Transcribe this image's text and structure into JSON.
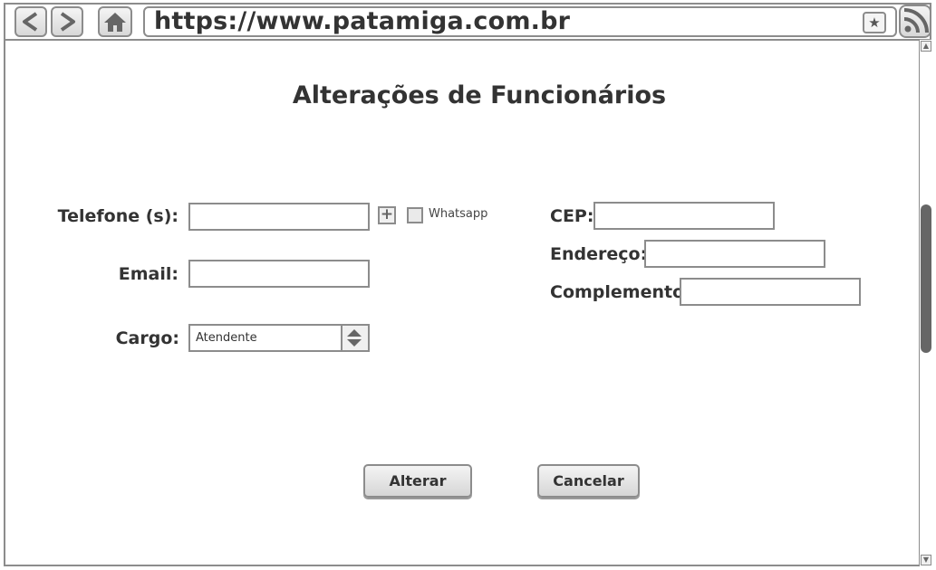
{
  "browser": {
    "url": "https://www.patamiga.com.br",
    "back_icon": "chevron-left-icon",
    "forward_icon": "chevron-right-icon",
    "home_icon": "home-icon",
    "bookmark_icon": "star-icon",
    "feed_icon": "rss-icon"
  },
  "page": {
    "title": "Alterações de Funcionários"
  },
  "form": {
    "telefone_label": "Telefone (s):",
    "telefone_value": "",
    "whatsapp_label": "Whatsapp",
    "whatsapp_checked": false,
    "email_label": "Email:",
    "email_value": "",
    "cargo_label": "Cargo:",
    "cargo_value": "Atendente",
    "cep_label": "CEP:",
    "cep_value": "",
    "endereco_label": "Endereço:",
    "endereco_value": "",
    "complemento_label": "Complemento",
    "complemento_value": ""
  },
  "actions": {
    "alterar_label": "Alterar",
    "cancelar_label": "Cancelar"
  },
  "colors": {
    "border": "#8c8c8c",
    "text": "#333333",
    "scroll_thumb": "#666666"
  }
}
